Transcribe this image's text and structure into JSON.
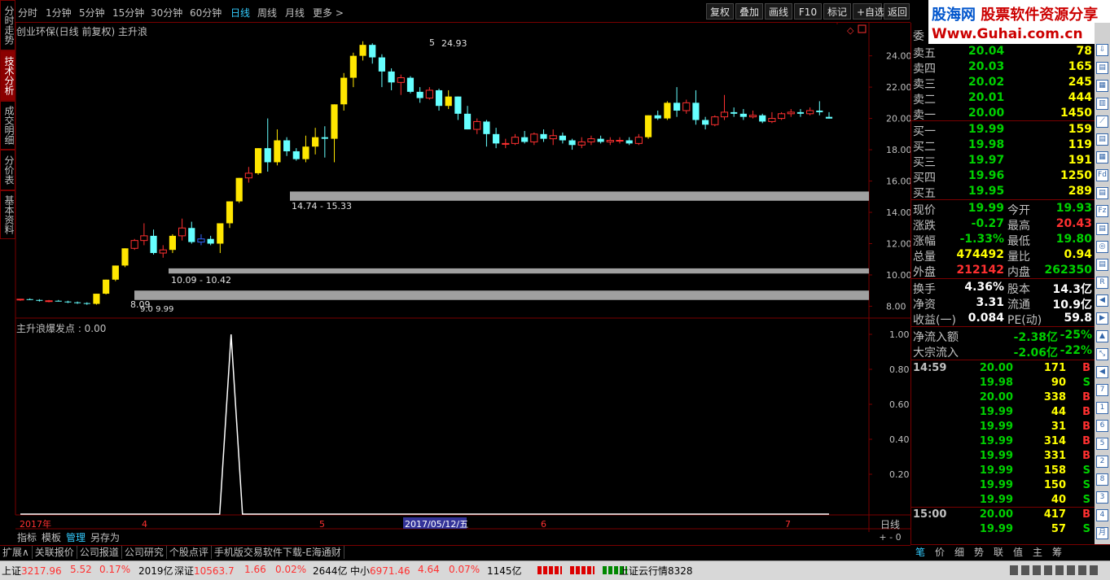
{
  "toolbar": {
    "periods": [
      "分时",
      "1分钟",
      "5分钟",
      "15分钟",
      "30分钟",
      "60分钟",
      "日线",
      "周线",
      "月线",
      "更多 >"
    ],
    "active_period": "日线",
    "buttons": [
      "复权",
      "叠加",
      "画线",
      "F10",
      "标记",
      "+自选",
      "返回"
    ]
  },
  "left_tabs": [
    "分时走势",
    "技术分析",
    "成交明细",
    "分价表",
    "基本资料"
  ],
  "active_left_tab": "技术分析",
  "chart": {
    "title": "创业环保(日线 前复权) 主升浪",
    "y_labels": [
      "24.00",
      "22.00",
      "20.00",
      "18.00",
      "16.00",
      "14.00",
      "12.00",
      "10.00",
      "8.00"
    ],
    "annotations": {
      "high_label": "24.93",
      "high_marker": "5",
      "zone1": "14.74 - 15.33",
      "zone2": "10.09 - 10.42",
      "low_label": "8.09",
      "zone3_partial": "9.0   9.99"
    },
    "indicator_title": "主升浪爆发点 : 0.00",
    "indicator_y_labels": [
      "1.00",
      "0.80",
      "0.60",
      "0.40",
      "0.20"
    ],
    "x_labels": [
      "2017年",
      "4",
      "5",
      "2017/05/12/五",
      "6",
      "7"
    ],
    "period_label": "日线",
    "zoom_controls": "+ - 0"
  },
  "chart_data": {
    "type": "candlestick",
    "title": "创业环保(日线 前复权) 主升浪",
    "ylim": [
      7.4,
      25.8
    ],
    "candles": [
      [
        8.4,
        8.45,
        8.35,
        8.45
      ],
      [
        8.45,
        8.5,
        8.4,
        8.4
      ],
      [
        8.4,
        8.45,
        8.3,
        8.35
      ],
      [
        8.3,
        8.4,
        8.25,
        8.35
      ],
      [
        8.35,
        8.4,
        8.3,
        8.3
      ],
      [
        8.3,
        8.35,
        8.2,
        8.25
      ],
      [
        8.25,
        8.3,
        8.15,
        8.2
      ],
      [
        8.2,
        8.25,
        8.09,
        8.15
      ],
      [
        8.15,
        8.8,
        8.1,
        8.8
      ],
      [
        8.8,
        9.7,
        8.75,
        9.7
      ],
      [
        9.7,
        10.6,
        9.6,
        10.6
      ],
      [
        10.6,
        11.7,
        10.5,
        11.7
      ],
      [
        11.7,
        12.3,
        11.6,
        12.2
      ],
      [
        12.2,
        13.3,
        11.9,
        12.5
      ],
      [
        12.5,
        12.9,
        11.3,
        11.4
      ],
      [
        11.4,
        11.9,
        11.1,
        11.6
      ],
      [
        11.6,
        12.6,
        11.4,
        12.5
      ],
      [
        12.5,
        13.6,
        12.2,
        13.0
      ],
      [
        13.0,
        13.4,
        12.0,
        12.1
      ],
      [
        12.1,
        12.6,
        11.9,
        12.3
      ],
      [
        12.3,
        12.5,
        11.9,
        12.0
      ],
      [
        12.0,
        13.3,
        11.4,
        13.3
      ],
      [
        13.3,
        14.7,
        13.0,
        14.7
      ],
      [
        14.7,
        16.2,
        14.6,
        16.2
      ],
      [
        16.2,
        16.9,
        15.9,
        16.5
      ],
      [
        16.5,
        18.1,
        16.4,
        18.1
      ],
      [
        18.1,
        20.0,
        16.6,
        17.2
      ],
      [
        17.2,
        19.3,
        17.0,
        18.6
      ],
      [
        18.6,
        18.8,
        17.6,
        17.9
      ],
      [
        17.9,
        18.1,
        17.3,
        17.4
      ],
      [
        17.4,
        18.9,
        17.2,
        18.2
      ],
      [
        18.2,
        19.4,
        17.7,
        18.8
      ],
      [
        18.8,
        19.5,
        17.5,
        18.7
      ],
      [
        18.7,
        20.9,
        17.2,
        20.9
      ],
      [
        20.9,
        22.9,
        20.5,
        22.6
      ],
      [
        22.6,
        24.2,
        22.0,
        24.0
      ],
      [
        24.0,
        24.93,
        23.7,
        24.7
      ],
      [
        24.7,
        24.8,
        23.5,
        23.9
      ],
      [
        23.9,
        24.1,
        22.0,
        23.0
      ],
      [
        23.0,
        23.2,
        21.8,
        22.3
      ],
      [
        22.3,
        22.8,
        21.5,
        22.6
      ],
      [
        22.6,
        22.7,
        21.6,
        21.7
      ],
      [
        21.7,
        22.0,
        21.0,
        21.3
      ],
      [
        21.3,
        22.0,
        21.2,
        21.8
      ],
      [
        21.8,
        21.9,
        20.5,
        20.8
      ],
      [
        20.8,
        21.8,
        20.6,
        21.4
      ],
      [
        21.4,
        21.4,
        19.9,
        20.3
      ],
      [
        20.3,
        20.8,
        19.3,
        19.3
      ],
      [
        19.3,
        20.0,
        19.0,
        19.8
      ],
      [
        19.8,
        19.9,
        18.2,
        19.0
      ],
      [
        19.0,
        19.4,
        18.1,
        18.4
      ],
      [
        18.4,
        18.7,
        18.1,
        18.4
      ],
      [
        18.4,
        19.0,
        18.3,
        18.8
      ],
      [
        18.8,
        19.2,
        18.4,
        18.5
      ],
      [
        18.5,
        19.1,
        18.3,
        19.0
      ],
      [
        19.0,
        19.3,
        18.5,
        18.7
      ],
      [
        18.7,
        19.3,
        18.3,
        18.9
      ],
      [
        18.9,
        19.1,
        18.4,
        18.6
      ],
      [
        18.6,
        18.7,
        18.0,
        18.3
      ],
      [
        18.3,
        18.8,
        18.1,
        18.5
      ],
      [
        18.5,
        18.9,
        18.3,
        18.7
      ],
      [
        18.7,
        18.9,
        18.4,
        18.5
      ],
      [
        18.5,
        18.8,
        18.3,
        18.6
      ],
      [
        18.6,
        18.8,
        18.4,
        18.6
      ],
      [
        18.6,
        18.8,
        18.3,
        18.4
      ],
      [
        18.4,
        19.0,
        18.3,
        18.8
      ],
      [
        18.8,
        20.2,
        18.7,
        20.2
      ],
      [
        20.2,
        20.5,
        19.9,
        20.0
      ],
      [
        20.0,
        21.1,
        19.9,
        21.0
      ],
      [
        21.0,
        22.0,
        20.1,
        20.5
      ],
      [
        20.5,
        21.2,
        20.3,
        21.0
      ],
      [
        21.0,
        21.8,
        19.6,
        19.9
      ],
      [
        19.9,
        20.1,
        19.3,
        19.6
      ],
      [
        19.6,
        20.2,
        19.5,
        20.1
      ],
      [
        20.1,
        21.5,
        19.9,
        20.4
      ],
      [
        20.4,
        20.7,
        20.1,
        20.3
      ],
      [
        20.3,
        20.6,
        19.9,
        20.1
      ],
      [
        20.1,
        20.5,
        20.0,
        20.2
      ],
      [
        20.2,
        20.3,
        19.7,
        19.8
      ],
      [
        19.8,
        20.4,
        19.7,
        20.0
      ],
      [
        20.0,
        20.4,
        19.9,
        20.3
      ],
      [
        20.3,
        20.6,
        20.1,
        20.4
      ],
      [
        20.4,
        20.6,
        20.1,
        20.3
      ],
      [
        20.3,
        20.7,
        20.2,
        20.5
      ],
      [
        20.5,
        21.1,
        20.2,
        20.4
      ],
      [
        20.1,
        20.4,
        19.99,
        19.99
      ]
    ],
    "signal_peak": 1.0
  },
  "quote": {
    "logo_line1_a": "股海网",
    "logo_line1_b": "股票软件资源分享",
    "logo_line2": "Www.Guhai.com.cn",
    "weibi_label": "委",
    "asks": [
      {
        "label": "卖五",
        "price": "20.04",
        "vol": "78"
      },
      {
        "label": "卖四",
        "price": "20.03",
        "vol": "165"
      },
      {
        "label": "卖三",
        "price": "20.02",
        "vol": "245"
      },
      {
        "label": "卖二",
        "price": "20.01",
        "vol": "444"
      },
      {
        "label": "卖一",
        "price": "20.00",
        "vol": "1450"
      }
    ],
    "bids": [
      {
        "label": "买一",
        "price": "19.99",
        "vol": "159"
      },
      {
        "label": "买二",
        "price": "19.98",
        "vol": "119"
      },
      {
        "label": "买三",
        "price": "19.97",
        "vol": "191"
      },
      {
        "label": "买四",
        "price": "19.96",
        "vol": "1250"
      },
      {
        "label": "买五",
        "price": "19.95",
        "vol": "289"
      }
    ],
    "stats": [
      {
        "l1": "现价",
        "v1": "19.99",
        "c1": "grn",
        "l2": "今开",
        "v2": "19.93",
        "c2": "grn"
      },
      {
        "l1": "涨跌",
        "v1": "-0.27",
        "c1": "grn",
        "l2": "最高",
        "v2": "20.43",
        "c2": "red"
      },
      {
        "l1": "涨幅",
        "v1": "-1.33%",
        "c1": "grn",
        "l2": "最低",
        "v2": "19.80",
        "c2": "grn"
      },
      {
        "l1": "总量",
        "v1": "474492",
        "c1": "yel",
        "l2": "量比",
        "v2": "0.94",
        "c2": "yel"
      },
      {
        "l1": "外盘",
        "v1": "212142",
        "c1": "red",
        "l2": "内盘",
        "v2": "262350",
        "c2": "grn"
      }
    ],
    "stats2": [
      {
        "l1": "换手",
        "v1": "4.36%",
        "l2": "股本",
        "v2": "14.3亿"
      },
      {
        "l1": "净资",
        "v1": "3.31",
        "l2": "流通",
        "v2": "10.9亿"
      },
      {
        "l1": "收益(一)",
        "v1": "0.084",
        "l2": "PE(动)",
        "v2": "59.8"
      }
    ],
    "flows": [
      {
        "label": "净流入额",
        "v1": "-2.38亿",
        "v2": "-25%"
      },
      {
        "label": "大宗流入",
        "v1": "-2.06亿",
        "v2": "-22%"
      }
    ],
    "ticks": [
      {
        "t": "14:59",
        "p": "20.00",
        "pc": "grn",
        "v": "171",
        "bs": "B"
      },
      {
        "t": "",
        "p": "19.98",
        "pc": "grn",
        "v": "90",
        "bs": "S"
      },
      {
        "t": "",
        "p": "20.00",
        "pc": "grn",
        "v": "338",
        "bs": "B"
      },
      {
        "t": "",
        "p": "19.99",
        "pc": "grn",
        "v": "44",
        "bs": "B"
      },
      {
        "t": "",
        "p": "19.99",
        "pc": "grn",
        "v": "31",
        "bs": "B"
      },
      {
        "t": "",
        "p": "19.99",
        "pc": "grn",
        "v": "314",
        "bs": "B"
      },
      {
        "t": "",
        "p": "19.99",
        "pc": "grn",
        "v": "331",
        "bs": "B"
      },
      {
        "t": "",
        "p": "19.99",
        "pc": "grn",
        "v": "158",
        "bs": "S"
      },
      {
        "t": "",
        "p": "19.99",
        "pc": "grn",
        "v": "150",
        "bs": "S"
      },
      {
        "t": "",
        "p": "19.99",
        "pc": "grn",
        "v": "40",
        "bs": "S"
      },
      {
        "t": "15:00",
        "p": "20.00",
        "pc": "grn",
        "v": "417",
        "bs": "B"
      },
      {
        "t": "",
        "p": "19.99",
        "pc": "grn",
        "v": "57",
        "bs": "S"
      }
    ],
    "bottom_tabs": [
      "笔",
      "价",
      "细",
      "势",
      "联",
      "值",
      "主",
      "筹"
    ],
    "active_bottom_tab": "笔"
  },
  "indicator_tabs": [
    "指标",
    "模板",
    "管理",
    "另存为"
  ],
  "active_indicator_tab": "管理",
  "link_bar": [
    "扩展∧",
    "关联报价",
    "公司报道",
    "公司研究",
    "个股点评",
    "手机版交易软件下载-E海通财"
  ],
  "status": {
    "sh_label": "上证",
    "sh_val": "3217.96",
    "sh_chg": "5.52",
    "sh_pct": "0.17%",
    "sh_amt": "2019亿",
    "sz_label": "深证",
    "sz_val": "10563.7",
    "sz_chg": "1.66",
    "sz_pct": "0.02%",
    "sz_amt": "2644亿",
    "zx_label": "中小",
    "zx_val": "6971.46",
    "zx_chg": "4.64",
    "zx_pct": "0.07%",
    "zx_amt": "1145亿",
    "cloud": "上证云行情8328"
  },
  "colors": {
    "up": "#ffe600",
    "down": "#66ffff",
    "small_up": "#ff3030",
    "small_down": "#66ffff",
    "zone": "#a0a0a0",
    "grid": "#7a0000"
  }
}
